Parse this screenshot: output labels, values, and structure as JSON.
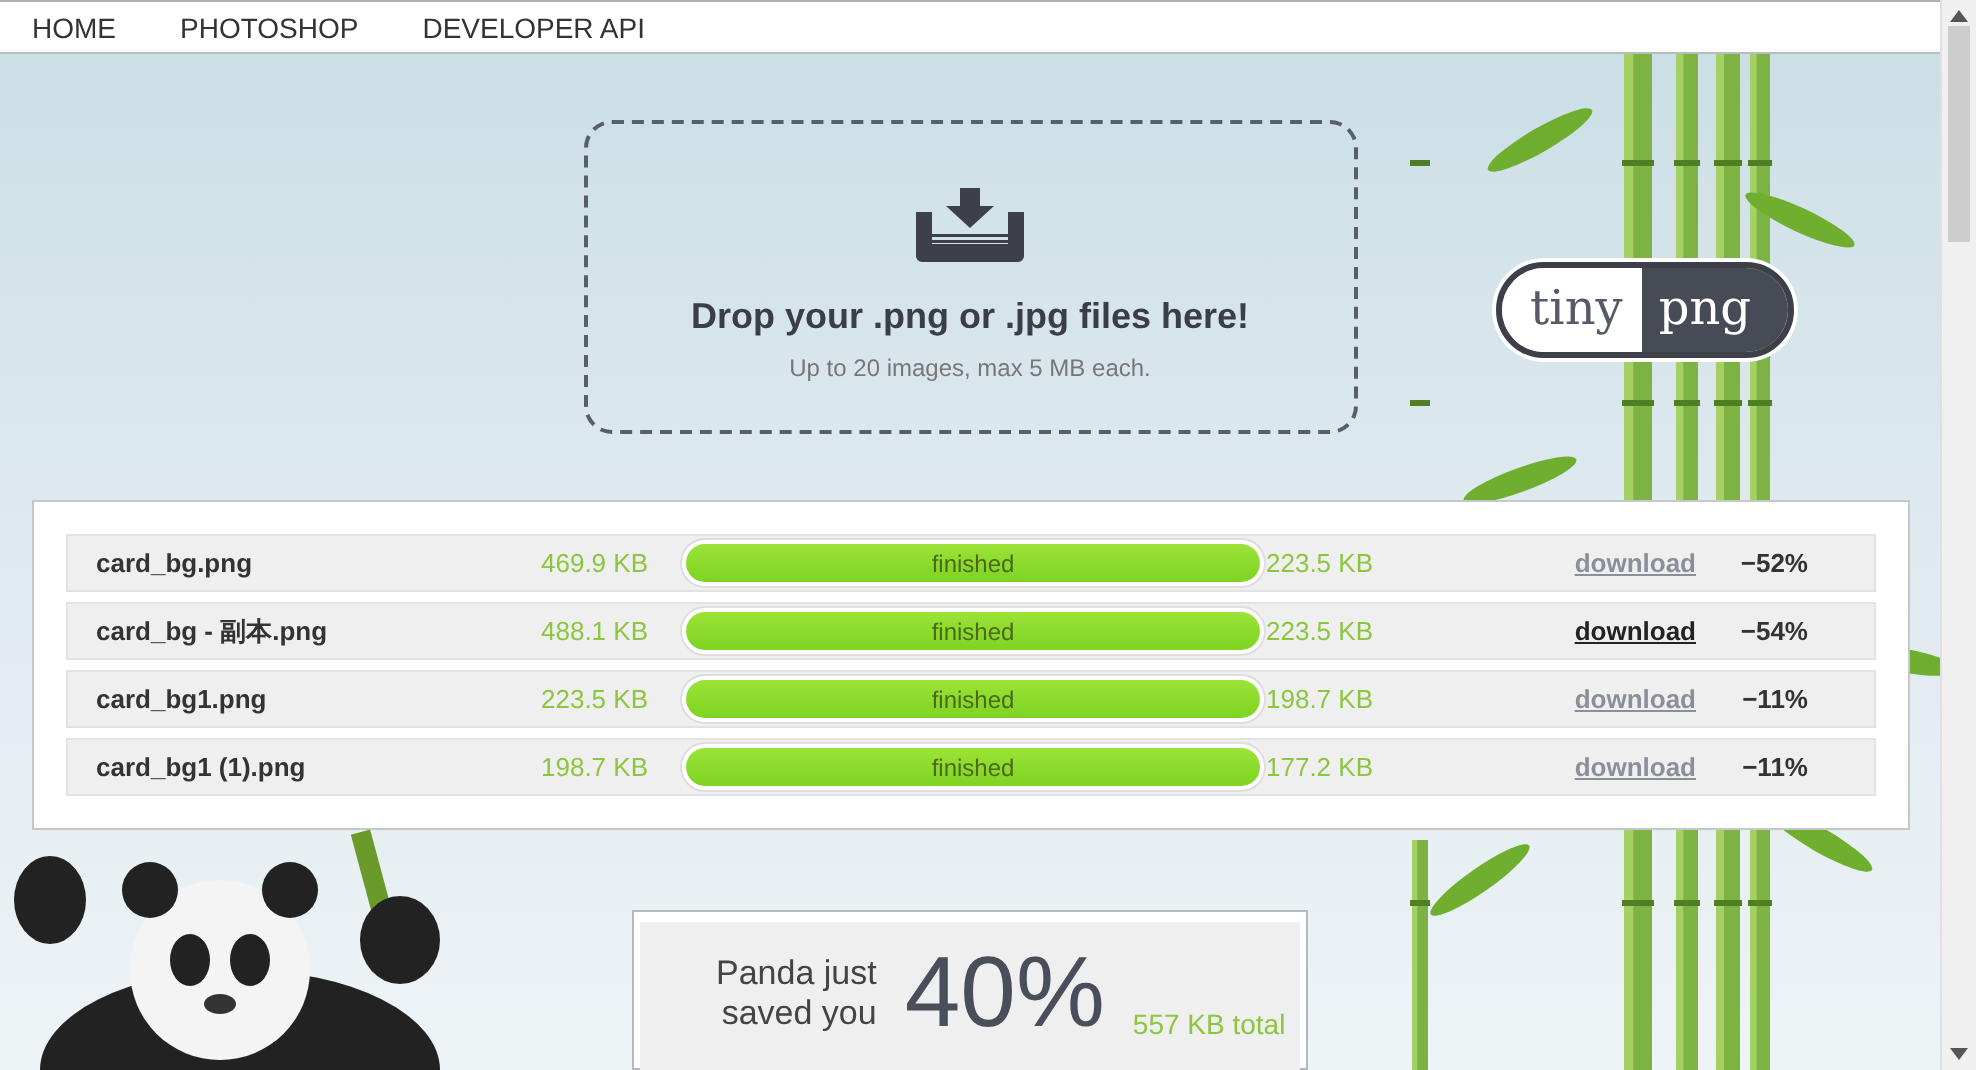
{
  "nav": [
    {
      "label": "HOME"
    },
    {
      "label": "PHOTOSHOP"
    },
    {
      "label": "DEVELOPER API"
    }
  ],
  "dropzone": {
    "title": "Drop your .png or .jpg files here!",
    "subtitle": "Up to 20 images, max 5 MB each."
  },
  "logo": {
    "left": "tiny",
    "right": "png"
  },
  "files": [
    {
      "name": "card_bg.png",
      "original_size": "469.9 KB",
      "status": "finished",
      "level": 1,
      "compressed_size": "223.5 KB",
      "link": "download",
      "hovered": false,
      "savings": "−52%"
    },
    {
      "name": "card_bg - 副本.png",
      "original_size": "488.1 KB",
      "status": "finished",
      "level": 1,
      "compressed_size": "223.5 KB",
      "link": "download",
      "hovered": true,
      "savings": "−54%"
    },
    {
      "name": "card_bg1.png",
      "original_size": "223.5 KB",
      "status": "finished",
      "level": 1,
      "compressed_size": "198.7 KB",
      "link": "download",
      "hovered": false,
      "savings": "−11%"
    },
    {
      "name": "card_bg1 (1).png",
      "original_size": "198.7 KB",
      "status": "finished",
      "level": 1,
      "compressed_size": "177.2 KB",
      "link": "download",
      "hovered": false,
      "savings": "−11%"
    }
  ],
  "summary": {
    "lead": [
      "Panda just",
      "saved you"
    ],
    "percent": "40%",
    "total": "557 KB total"
  }
}
